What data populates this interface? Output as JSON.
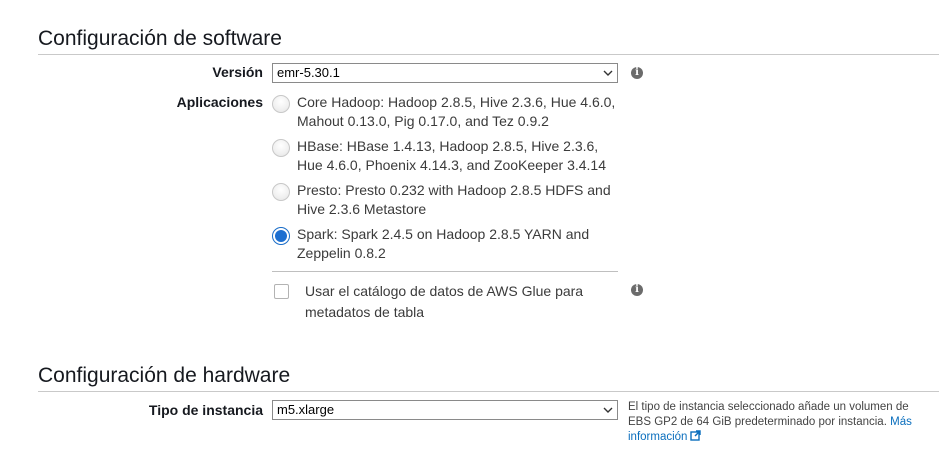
{
  "software": {
    "title": "Configuración de software",
    "version_label": "Versión",
    "version_value": "emr-5.30.1",
    "applications_label": "Aplicaciones",
    "applications": [
      {
        "line1": "Core Hadoop: Hadoop 2.8.5, Hive 2.3.6, Hue 4.6.0,",
        "line2": "Mahout 0.13.0, Pig 0.17.0, and Tez 0.9.2",
        "selected": false
      },
      {
        "line1": "HBase: HBase 1.4.13, Hadoop 2.8.5, Hive 2.3.6,",
        "line2": "Hue 4.6.0, Phoenix 4.14.3, and ZooKeeper 3.4.14",
        "selected": false
      },
      {
        "line1": "Presto: Presto 0.232 with Hadoop 2.8.5 HDFS and",
        "line2": "Hive 2.3.6 Metastore",
        "selected": false
      },
      {
        "line1": "Spark: Spark 2.4.5 on Hadoop 2.8.5 YARN and",
        "line2": "Zeppelin 0.8.2",
        "selected": true
      }
    ],
    "glue_checkbox": {
      "line1": "Usar el catálogo de datos de AWS Glue para",
      "line2": "metadatos de tabla",
      "checked": false
    }
  },
  "hardware": {
    "title": "Configuración de hardware",
    "instance_label": "Tipo de instancia",
    "instance_value": "m5.xlarge",
    "hint_text": "El tipo de instancia seleccionado añade un volumen de EBS GP2 de 64 GiB predeterminado por instancia.",
    "hint_link_1": "Más",
    "hint_link_2": "información"
  },
  "colors": {
    "accent": "#1d6fd0",
    "link": "#0a6ebd",
    "rule": "#c9c9c9"
  },
  "icons": [
    "info-icon",
    "chevron-down-icon",
    "external-link-icon"
  ]
}
